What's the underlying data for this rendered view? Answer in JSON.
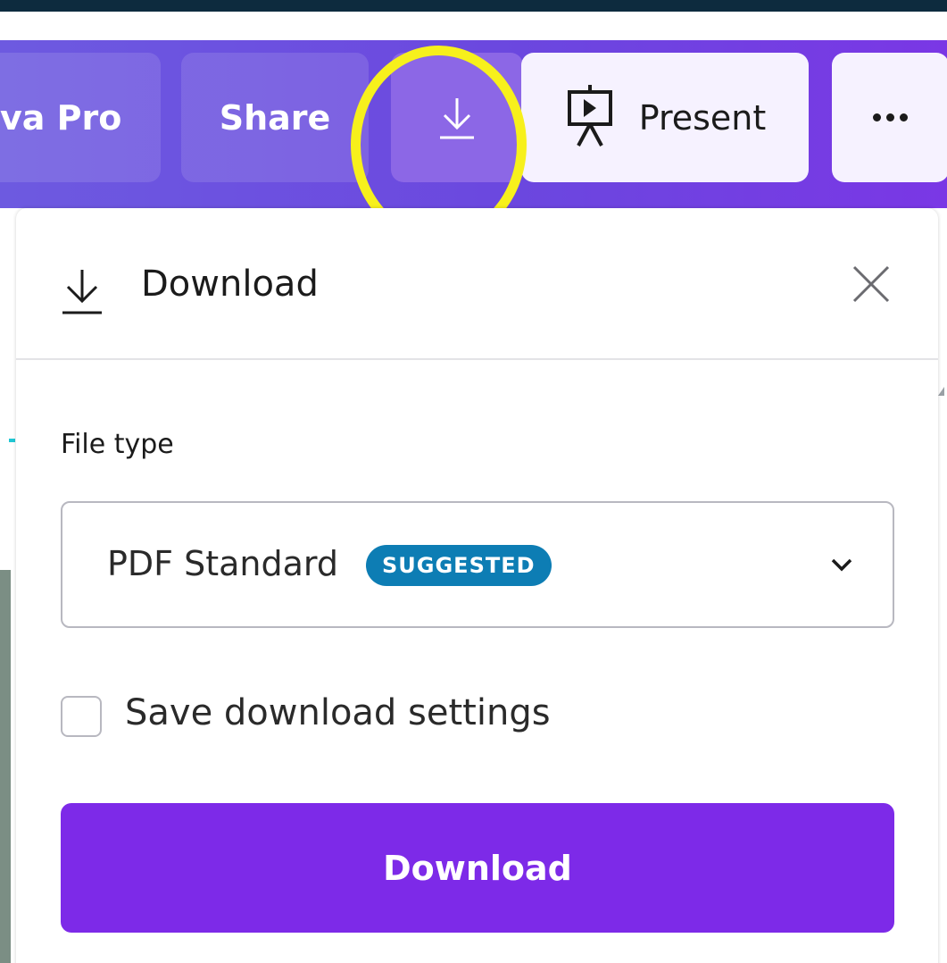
{
  "toolbar": {
    "pro_label": "va Pro",
    "share_label": "Share",
    "download_icon": "download-arrow-icon",
    "present_label": "Present",
    "present_icon": "presentation-screen-icon",
    "more_icon": "more-dots-icon"
  },
  "download_panel": {
    "title": "Download",
    "title_icon": "download-arrow-icon",
    "close_icon": "close-icon",
    "file_type_label": "File type",
    "file_type_value": "PDF Standard",
    "file_type_badge": "SUGGESTED",
    "chevron_icon": "chevron-down-icon",
    "save_settings_label": "Save download settings",
    "save_settings_checked": false,
    "download_button_label": "Download"
  },
  "colors": {
    "toolbar_gradient_start": "#6d5ae0",
    "toolbar_gradient_end": "#7a37e5",
    "highlight_ring": "#f7f01c",
    "badge": "#0d7db4",
    "primary_button": "#7d2ae8"
  }
}
